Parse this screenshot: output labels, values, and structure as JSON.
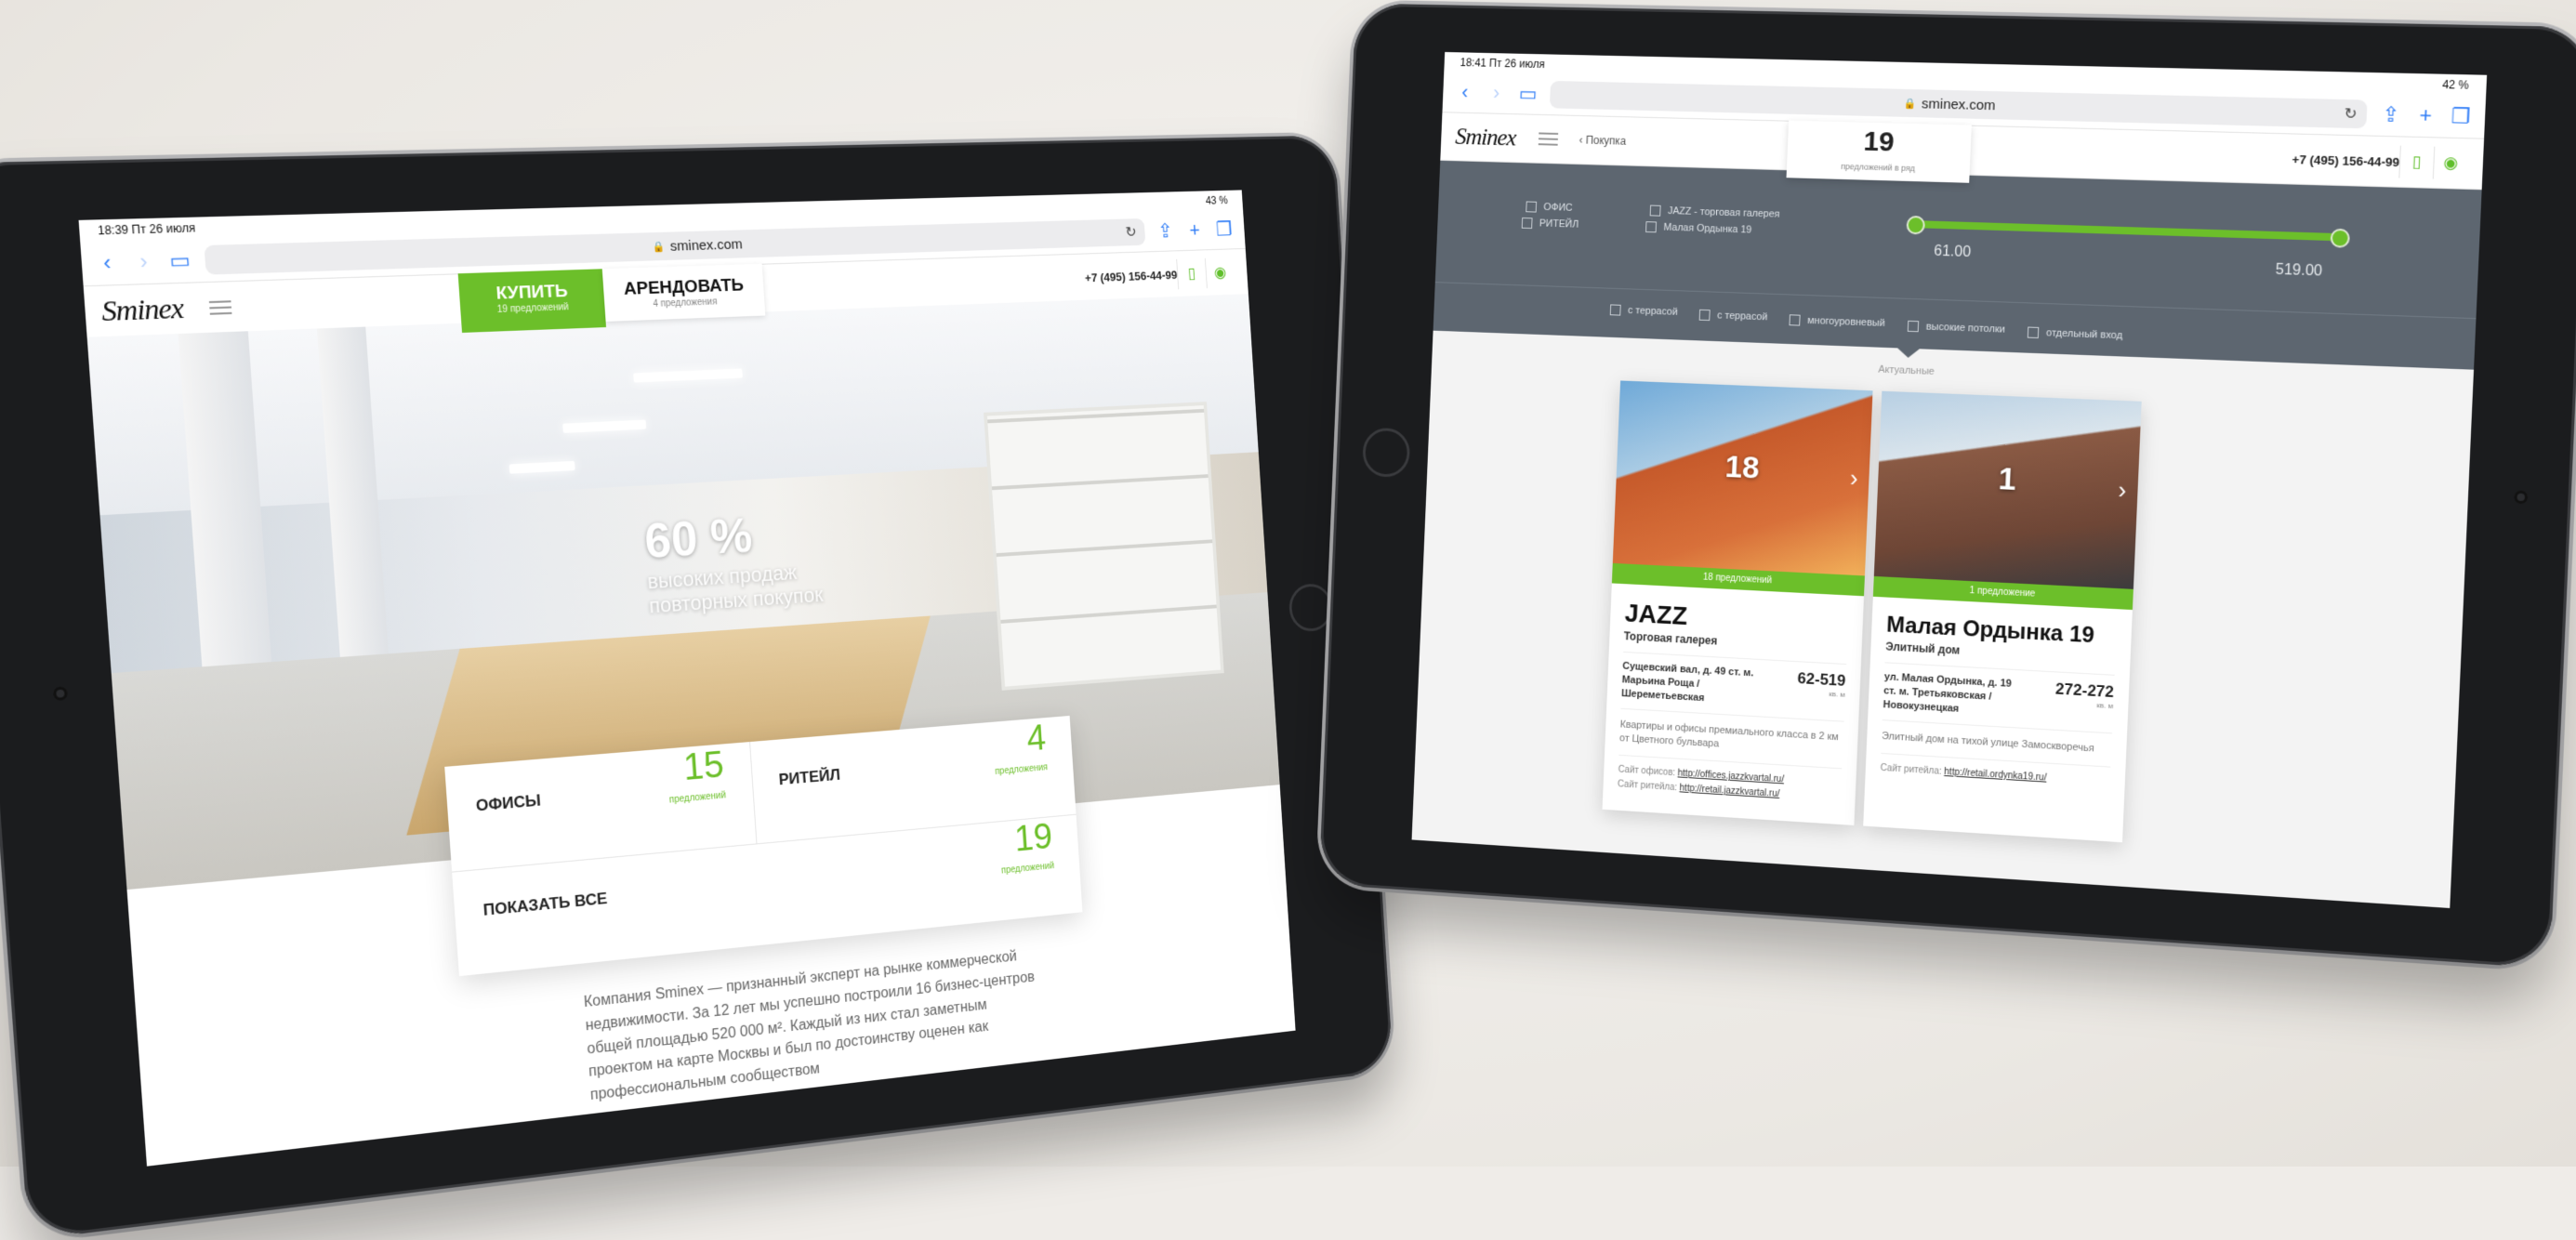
{
  "left": {
    "status": {
      "time": "18:39  Пт 26 июля",
      "battery": "43 %"
    },
    "browser": {
      "url": "sminex.com"
    },
    "site": {
      "logo": "Sminex",
      "phone": "+7 (495) 156-44-99",
      "tab_buy": {
        "label": "КУПИТЬ",
        "sub": "19 предложений"
      },
      "tab_rent": {
        "label": "АРЕНДОВАТЬ",
        "sub": "4 предложения"
      },
      "hero": {
        "value": "60 %",
        "caption_1": "высоких продаж",
        "caption_2": "повторных покупок"
      },
      "categories": [
        {
          "name": "ОФИСЫ",
          "count": "15",
          "unit": "предложений"
        },
        {
          "name": "РИТЕЙЛ",
          "count": "4",
          "unit": "предложения"
        },
        {
          "name": "ПОКАЗАТЬ ВСЕ",
          "count": "19",
          "unit": "предложений"
        }
      ],
      "about": "Компания Sminex — признанный эксперт на рынке коммерческой недвижимости. За 12 лет мы успешно построили 16 бизнес-центров общей площадью 520 000 м². Каждый из них стал заметным проектом на карте Москвы и был по достоинству оценен как профессиональным сообществом"
    }
  },
  "right": {
    "status": {
      "time": "18:41  Пт 26 июля",
      "battery": "42 %"
    },
    "browser": {
      "url": "sminex.com"
    },
    "site": {
      "logo": "Sminex",
      "crumb": "Покупка",
      "count": {
        "value": "19",
        "sub": "предложений в ряд"
      },
      "phone": "+7 (495) 156-44-99",
      "filters": {
        "types": [
          "ОФИС",
          "РИТЕЙЛ"
        ],
        "projects": [
          "JAZZ - торговая галерея",
          "Малая Ордынка 19"
        ],
        "range_min": "61.00",
        "range_max": "519.00",
        "features": [
          "с террасой",
          "с террасой",
          "многоуровневый",
          "высокие потолки",
          "отдельный вход"
        ]
      },
      "actual": "Актуальные",
      "cards": [
        {
          "count": "18",
          "band": "18 предложений",
          "title": "JAZZ",
          "subtitle": "Торговая галерея",
          "address": "Сущевский вал, д. 49 ст. м. Марьина Роща / Шереметьевская",
          "area": "62-519",
          "area_unit": "кв. м",
          "desc": "Квартиры и офисы премиального класса в 2 км от Цветного бульвара",
          "site1_label": "Сайт офисов:",
          "site1": "http://offices.jazzkvartal.ru/",
          "site2_label": "Сайт ритейла:",
          "site2": "http://retail.jazzkvartal.ru/"
        },
        {
          "count": "1",
          "band": "1 предложение",
          "title": "Малая Ордынка 19",
          "subtitle": "Элитный дом",
          "address": "ул. Малая Ордынка, д. 19 ст. м. Третьяковская / Новокузнецкая",
          "area": "272-272",
          "area_unit": "кв. м",
          "desc": "Элитный дом на тихой улице Замоскворечья",
          "site1_label": "Сайт ритейла:",
          "site1": "http://retail.ordynka19.ru/"
        }
      ]
    }
  },
  "colors": {
    "accent": "#6cbf2a",
    "filter_bg": "#5d6670"
  }
}
